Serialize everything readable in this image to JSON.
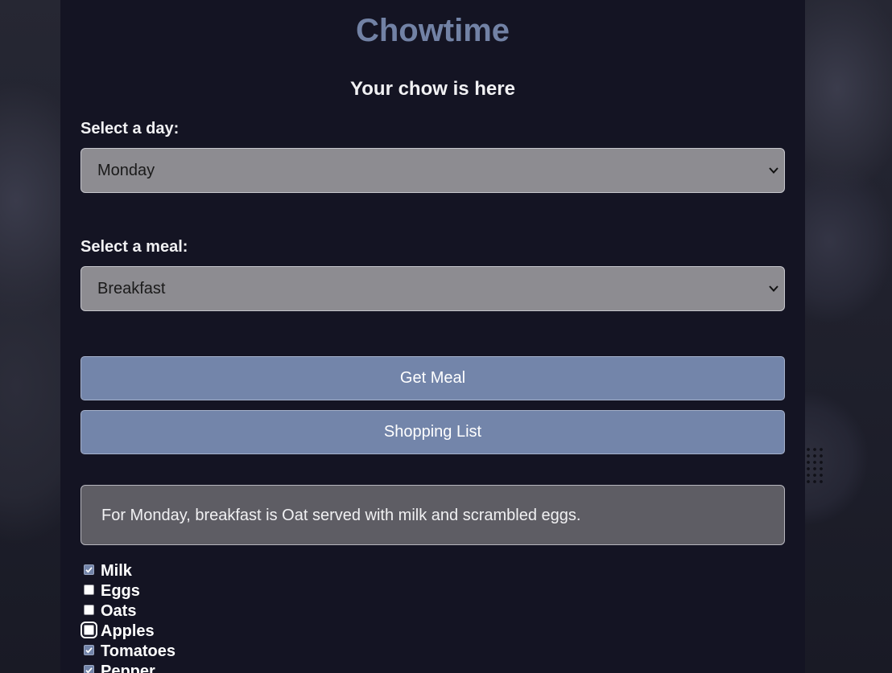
{
  "app": {
    "title": "Chowtime",
    "subtitle": "Your chow is here"
  },
  "day_select": {
    "label": "Select a day:",
    "value": "Monday"
  },
  "meal_select": {
    "label": "Select a meal:",
    "value": "Breakfast"
  },
  "buttons": {
    "get_meal": "Get Meal",
    "shopping_list": "Shopping List"
  },
  "result": {
    "text": "For Monday, breakfast is Oat served with milk and scrambled eggs."
  },
  "shopping_list": [
    {
      "label": "Milk",
      "checked": true
    },
    {
      "label": "Eggs",
      "checked": false
    },
    {
      "label": "Oats",
      "checked": false
    },
    {
      "label": "Apples",
      "checked": false,
      "focused": true
    },
    {
      "label": "Tomatoes",
      "checked": true
    },
    {
      "label": "Pepper",
      "checked": true
    }
  ],
  "colors": {
    "accent": "#7385aa",
    "title": "#7282a5",
    "panel": "#141423",
    "select_bg": "#8d8c91",
    "result_bg": "#5e5d64"
  },
  "icons": {
    "select_arrow": "chevron-down-icon",
    "checkbox_mark": "checkmark-icon"
  }
}
